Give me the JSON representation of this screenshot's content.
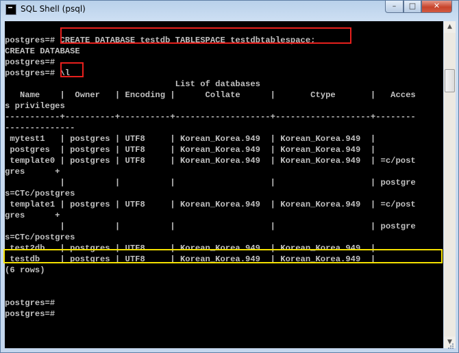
{
  "window": {
    "title": "SQL Shell (psql)"
  },
  "controls": {
    "minimize": "–",
    "maximize": "□",
    "close": "✕"
  },
  "console_lines": [
    "",
    "postgres=# CREATE DATABASE testdb TABLESPACE testdbtablespace;",
    "CREATE DATABASE",
    "postgres=#",
    "postgres=# \\l",
    "                                  List of databases",
    "   Name    |  Owner   | Encoding |      Collate      |       Ctype       |   Acces",
    "s privileges",
    "-----------+----------+----------+-------------------+-------------------+--------",
    "--------------",
    " mytest1   | postgres | UTF8     | Korean_Korea.949  | Korean_Korea.949  |",
    " postgres  | postgres | UTF8     | Korean_Korea.949  | Korean_Korea.949  |",
    " template0 | postgres | UTF8     | Korean_Korea.949  | Korean_Korea.949  | =c/post",
    "gres      +",
    "           |          |          |                   |                   | postgre",
    "s=CTc/postgres",
    " template1 | postgres | UTF8     | Korean_Korea.949  | Korean_Korea.949  | =c/post",
    "gres      +",
    "           |          |          |                   |                   | postgre",
    "s=CTc/postgres",
    " test2db   | postgres | UTF8     | Korean_Korea.949  | Korean_Korea.949  |",
    " testdb    | postgres | UTF8     | Korean_Korea.949  | Korean_Korea.949  |",
    "(6 rows)",
    "",
    "",
    "postgres=#",
    "postgres=#"
  ],
  "scrollbar": {
    "up_icon": "▲",
    "down_icon": "▼"
  },
  "highlight_colors": {
    "red": "#e8201d",
    "yellow": "#f6e200"
  }
}
